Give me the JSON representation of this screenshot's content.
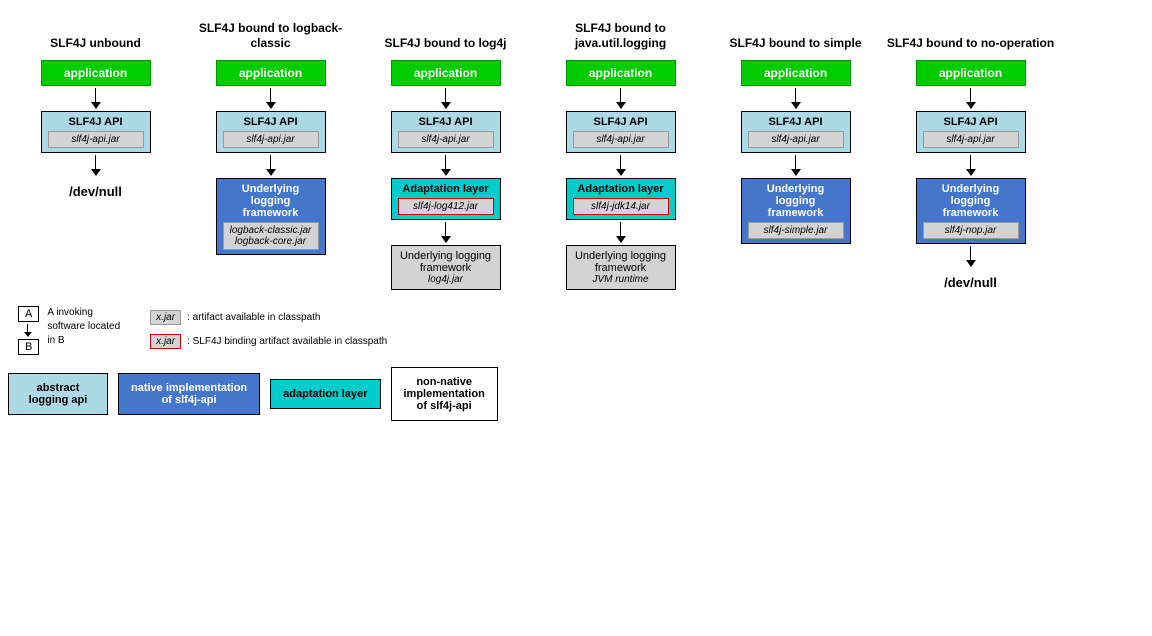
{
  "columns": [
    {
      "id": "unbound",
      "title": "SLF4J unbound",
      "app": "application",
      "api_title": "SLF4J API",
      "api_jar": "slf4j-api.jar",
      "steps": [
        "devnull"
      ],
      "devnull": "/dev/null"
    },
    {
      "id": "logback",
      "title": "SLF4J bound to logback-classic",
      "app": "application",
      "api_title": "SLF4J API",
      "api_jar": "slf4j-api.jar",
      "steps": [
        "underlying_native"
      ],
      "underlying_title": "Underlying logging framework",
      "underlying_jar": "logback-classic.jar\nlogback-core.jar"
    },
    {
      "id": "log4j",
      "title": "SLF4J bound to log4j",
      "app": "application",
      "api_title": "SLF4J API",
      "api_jar": "slf4j-api.jar",
      "steps": [
        "adaptation",
        "underlying_gray"
      ],
      "adaptation_title": "Adaptation layer",
      "adaptation_jar": "slf4j-log412.jar",
      "gray_title": "Underlying logging framework",
      "gray_jar": "log4j.jar"
    },
    {
      "id": "javautil",
      "title": "SLF4J bound to java.util.logging",
      "app": "application",
      "api_title": "SLF4J API",
      "api_jar": "slf4j-api.jar",
      "steps": [
        "adaptation",
        "underlying_gray"
      ],
      "adaptation_title": "Adaptation layer",
      "adaptation_jar": "slf4j-jdk14.jar",
      "gray_title": "Underlying logging framework",
      "gray_jar": "JVM runtime"
    },
    {
      "id": "simple",
      "title": "SLF4J bound to simple",
      "app": "application",
      "api_title": "SLF4J API",
      "api_jar": "slf4j-api.jar",
      "steps": [
        "underlying_native"
      ],
      "underlying_title": "Underlying logging framework",
      "underlying_jar": "slf4j-simple.jar"
    },
    {
      "id": "noop",
      "title": "SLF4J bound to no-operation",
      "app": "application",
      "api_title": "SLF4J API",
      "api_jar": "slf4j-api.jar",
      "steps": [
        "underlying_native",
        "devnull"
      ],
      "underlying_title": "Underlying logging framework",
      "underlying_jar": "slf4j-nop.jar",
      "devnull": "/dev/null"
    }
  ],
  "legend": {
    "invoke_a": "A",
    "invoke_b": "B",
    "invoke_text": "A invoking\nsoftware located\nin B",
    "jar_label": "x.jar",
    "jar_desc": ": artifact available in classpath",
    "binding_jar_label": "x.jar",
    "binding_jar_desc": ": SLF4J binding artifact available in classpath"
  },
  "bottom_legend": [
    {
      "id": "abstract",
      "color": "lightblue",
      "label": "abstract\nlogging api"
    },
    {
      "id": "native",
      "color": "blue",
      "label": "native implementation\nof slf4j-api"
    },
    {
      "id": "adaptation",
      "color": "cyan",
      "label": "adaptation layer"
    },
    {
      "id": "nonnative",
      "color": "white",
      "label": "non-native\nimplementation\nof slf4j-api"
    }
  ]
}
